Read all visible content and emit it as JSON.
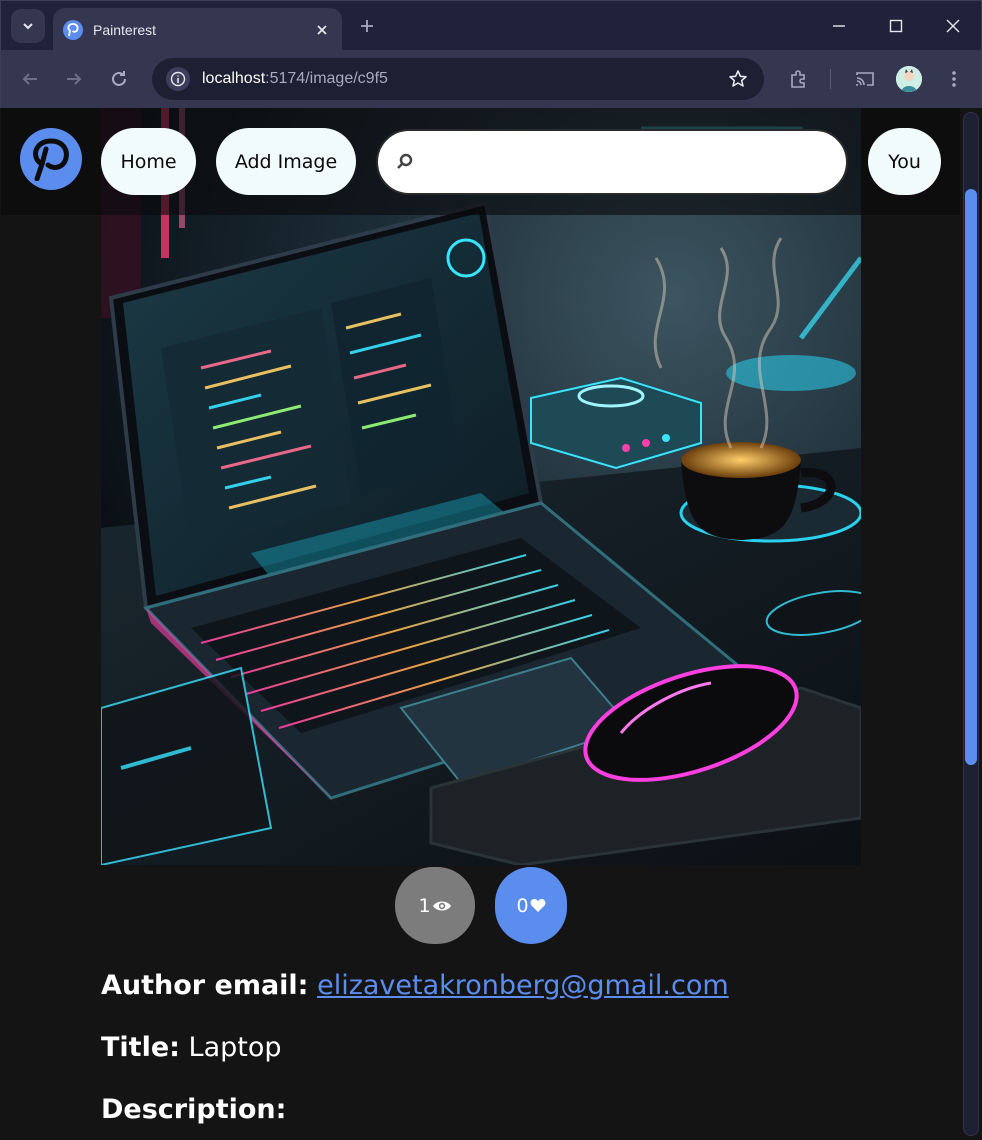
{
  "browser": {
    "tab_title": "Painterest",
    "url_host": "localhost",
    "url_path": ":5174/image/c9f5"
  },
  "icons": {
    "tab_search": "chevron-down-icon",
    "favicon": "pinterest-logo-icon",
    "tab_close": "close-icon",
    "new_tab": "plus-icon",
    "minimize": "minimize-icon",
    "maximize": "maximize-icon",
    "close_window": "close-icon",
    "back": "arrow-left-icon",
    "forward": "arrow-right-icon",
    "reload": "reload-icon",
    "site_info": "info-icon",
    "bookmark": "star-icon",
    "extensions": "puzzle-icon",
    "cast": "cast-icon",
    "menu": "kebab-menu-icon",
    "search": "search-icon",
    "views": "eye-icon",
    "likes": "heart-icon"
  },
  "header": {
    "home_label": "Home",
    "add_image_label": "Add Image",
    "search_placeholder": "",
    "you_label": "You"
  },
  "stats": {
    "views": "1",
    "likes": "0"
  },
  "details": {
    "author_label": "Author email:",
    "author_email": "elizavetakronberg@gmail.com",
    "title_label": "Title:",
    "title_value": "Laptop",
    "description_label": "Description:"
  },
  "colors": {
    "accent": "#5b8def",
    "page_background": "#141414",
    "pill_background": "#f1fbfb",
    "views_badge": "#7c7c7c"
  }
}
